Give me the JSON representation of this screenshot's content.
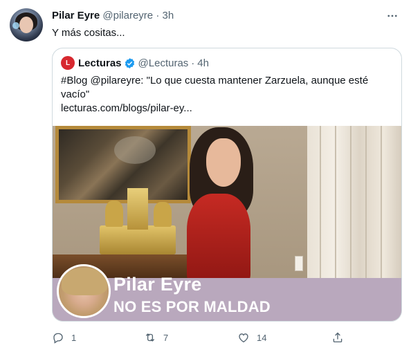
{
  "tweet": {
    "author": {
      "name": "Pilar Eyre",
      "handle": "@pilareyre",
      "separator": "·",
      "time": "3h"
    },
    "text": "Y más cositas...",
    "menu_icon": "more-horizontal-icon"
  },
  "quoted": {
    "author": {
      "name": "Lecturas",
      "handle": "@Lecturas",
      "separator": "·",
      "time": "4h",
      "logo_letter": "L",
      "verified": true
    },
    "text_line1": "#Blog @pilareyre: \"Lo que cuesta mantener Zarzuela, aunque esté",
    "text_line2": "vacío\"",
    "link": "lecturas.com/blogs/pilar-ey...",
    "image_banner": {
      "title": "Pilar Eyre",
      "subtitle": "NO ES POR MALDAD"
    }
  },
  "actions": {
    "reply": {
      "icon": "reply-icon",
      "count": "1"
    },
    "retweet": {
      "icon": "retweet-icon",
      "count": "7"
    },
    "like": {
      "icon": "heart-icon",
      "count": "14"
    },
    "share": {
      "icon": "share-icon"
    }
  },
  "colors": {
    "text": "#0f1419",
    "secondary": "#536471",
    "border": "#cfd9de",
    "verified": "#1d9bf0",
    "lecturas_red": "#d7282f",
    "banner": "#b9a8bd"
  }
}
